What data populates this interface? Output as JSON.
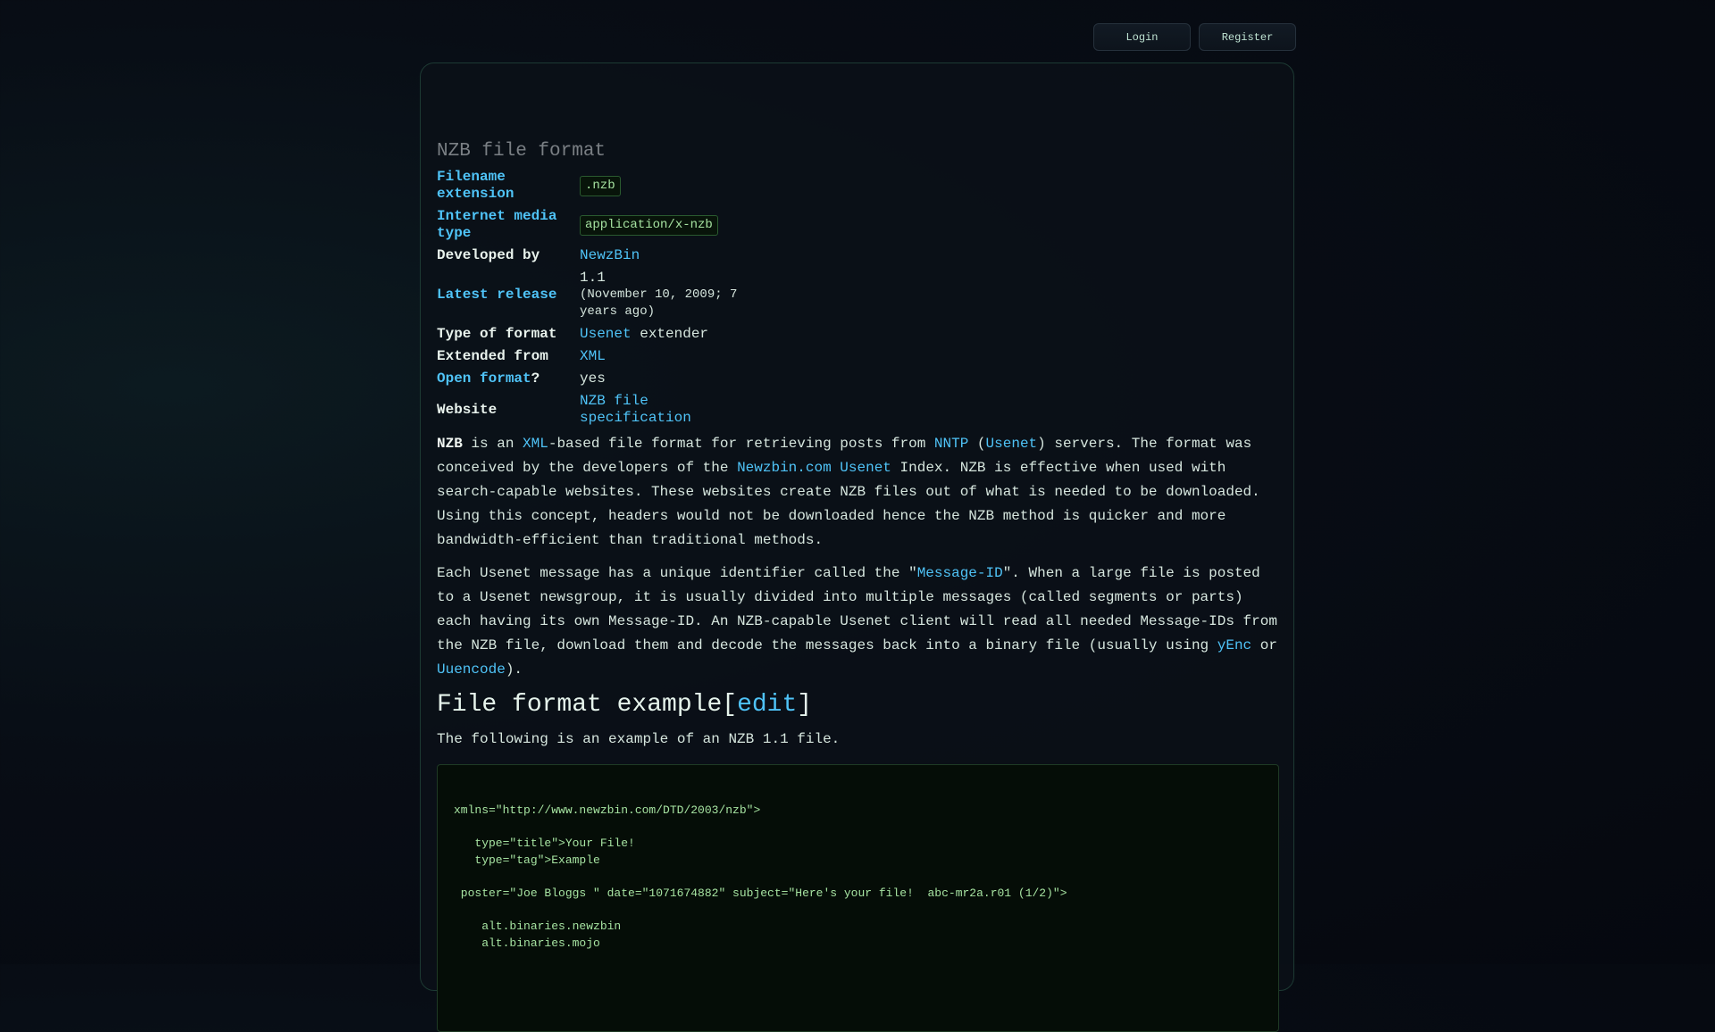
{
  "header": {
    "login": "Login",
    "register": "Register"
  },
  "article": {
    "infobox": {
      "title": "NZB file format",
      "rows": [
        {
          "label": "Filename extension",
          "value": ".nzb"
        },
        {
          "label": "Internet media type",
          "value": "application/x-nzb"
        },
        {
          "label": "Developed by",
          "value": "NewzBin"
        },
        {
          "label": "Latest release",
          "version": "1.1",
          "date": "(November 10, 2009; 7 years ago)"
        },
        {
          "label": "Type of format",
          "link": "Usenet",
          "rest": " extender"
        },
        {
          "label": "Extended from",
          "value": "XML"
        },
        {
          "label": "Open format",
          "suffix": "?",
          "value": "yes"
        },
        {
          "label": "Website",
          "value": "NZB file specification"
        }
      ]
    },
    "p1": {
      "b": "NZB",
      "t1": " is an ",
      "l1": "XML",
      "t2": "-based file format for retrieving posts from ",
      "l2": "NNTP",
      "t3": " (",
      "l3": "Usenet",
      "t4": ") servers. The format was conceived by the developers of the ",
      "l4": "Newzbin.com",
      "t5": " ",
      "l5": "Usenet",
      "t6": " Index. NZB is effective when used with search-capable websites. These websites create NZB files out of what is needed to be downloaded. Using this concept, headers would not be downloaded hence the NZB method is quicker and more bandwidth-efficient than traditional methods."
    },
    "p2": {
      "t1": "Each Usenet message has a unique identifier called the \"",
      "l1": "Message-ID",
      "t2": "\". When a large file is posted to a Usenet newsgroup, it is usually divided into multiple messages (called segments or parts) each having its own Message-ID. An NZB-capable Usenet client will read all needed Message-IDs from the NZB file, download them and decode the messages back into a binary file (usually using ",
      "l2": "yEnc",
      "t3": " or ",
      "l3": "Uuencode",
      "t4": ")."
    },
    "section": {
      "heading": "File format example",
      "edit_open": "[",
      "edit": "edit",
      "edit_close": "]"
    },
    "p3": "The following is an example of an NZB 1.1 file.",
    "code": "xmlns=\"http://www.newzbin.com/DTD/2003/nzb\">\n\n   type=\"title\">Your File!\n   type=\"tag\">Example\n\n poster=\"Joe Bloggs \" date=\"1071674882\" subject=\"Here's your file!  abc-mr2a.r01 (1/2)\">\n\n    alt.binaries.newzbin\n    alt.binaries.mojo"
  }
}
